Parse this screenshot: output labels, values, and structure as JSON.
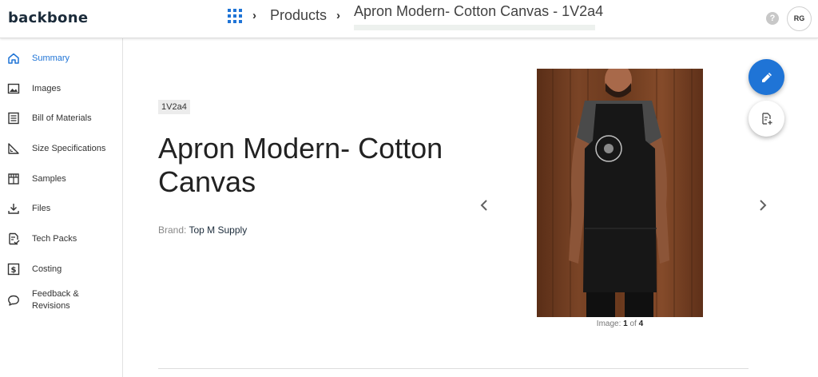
{
  "app": {
    "logo": "backbone"
  },
  "header": {
    "breadcrumb": {
      "section": "Products",
      "current": "Apron Modern- Cotton Canvas - 1V2a4"
    },
    "help_icon": "?",
    "avatar_initials": "RG"
  },
  "sidebar": {
    "items": [
      {
        "label": "Summary",
        "icon": "home-icon",
        "active": true
      },
      {
        "label": "Images",
        "icon": "image-icon"
      },
      {
        "label": "Bill of Materials",
        "icon": "list-icon"
      },
      {
        "label": "Size Specifications",
        "icon": "ruler-icon"
      },
      {
        "label": "Samples",
        "icon": "package-icon"
      },
      {
        "label": "Files",
        "icon": "download-icon"
      },
      {
        "label": "Tech Packs",
        "icon": "doc-check-icon"
      },
      {
        "label": "Costing",
        "icon": "dollar-icon"
      },
      {
        "label": "Feedback &",
        "label2": "Revisions",
        "icon": "chat-icon"
      }
    ]
  },
  "product": {
    "sku": "1V2a4",
    "title": "Apron Modern- Cotton Canvas",
    "brand_label": "Brand:",
    "brand_value": "Top M Supply"
  },
  "gallery": {
    "caption_label": "Image:",
    "current": "1",
    "of": "of",
    "total": "4"
  },
  "colors": {
    "accent": "#1f74d6",
    "text": "#212121",
    "muted": "#888888"
  }
}
